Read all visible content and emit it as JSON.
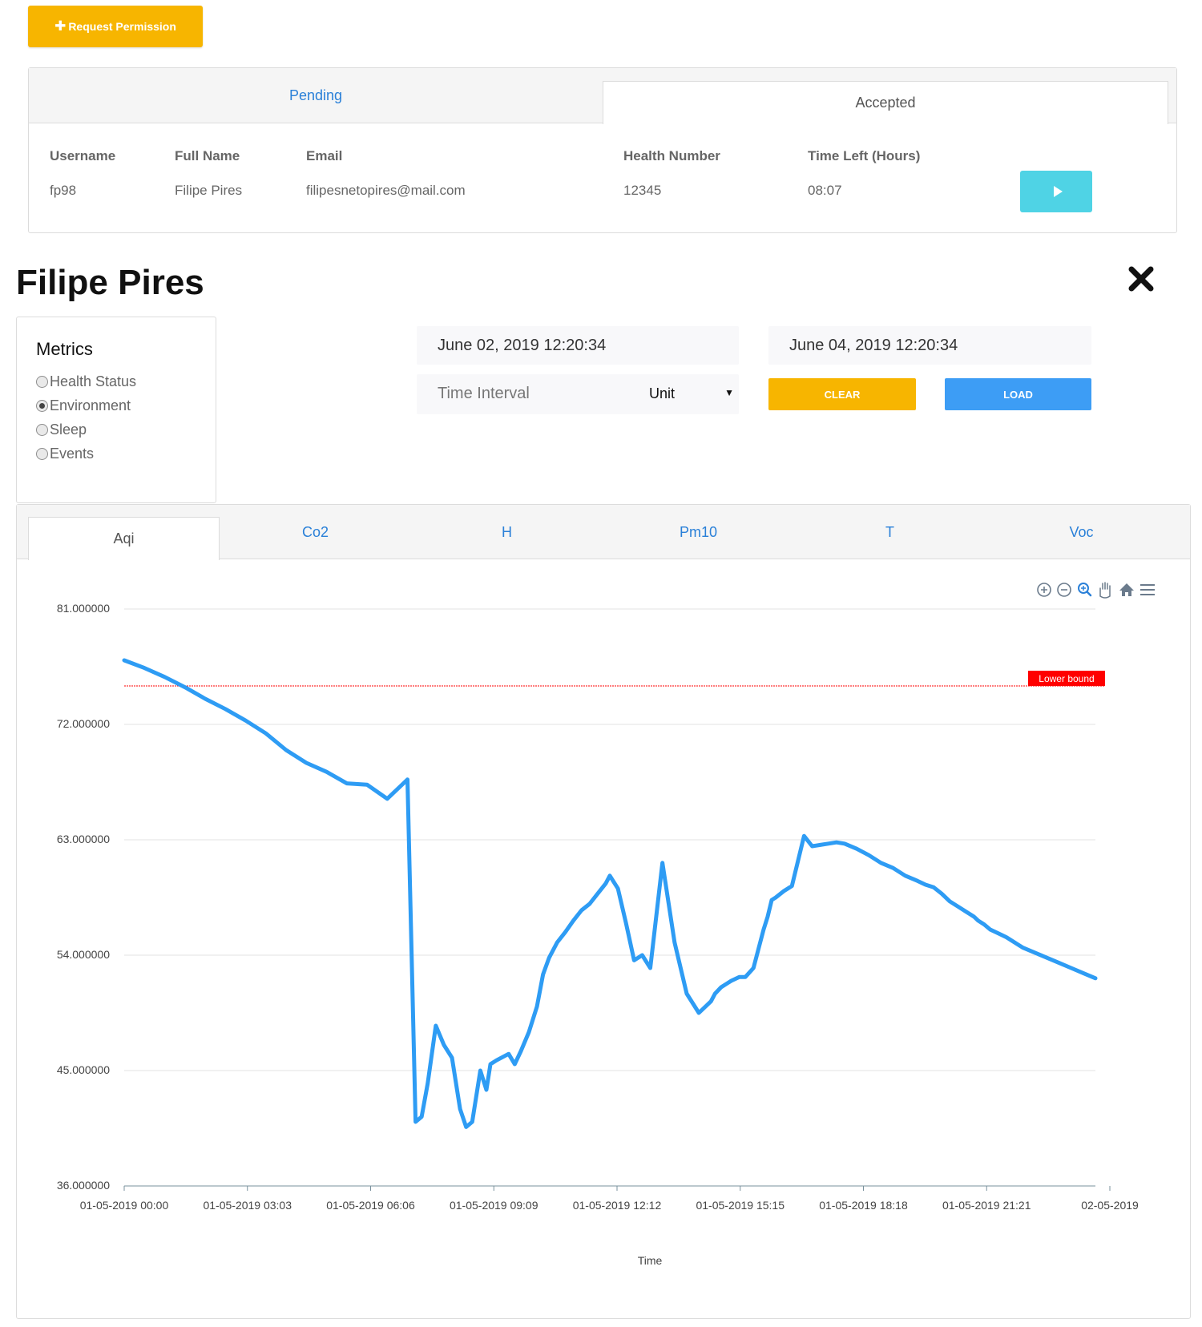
{
  "request_button": {
    "label": "Request Permission"
  },
  "permissions": {
    "tabs": [
      {
        "label": "Pending"
      },
      {
        "label": "Accepted"
      }
    ],
    "columns": [
      "Username",
      "Full Name",
      "Email",
      "Health Number",
      "Time Left (Hours)"
    ],
    "rows": [
      {
        "username": "fp98",
        "full_name": "Filipe Pires",
        "email": "filipesnetopires@mail.com",
        "health_number": "12345",
        "time_left": "08:07"
      }
    ]
  },
  "patient": {
    "name": "Filipe Pires"
  },
  "metrics": {
    "title": "Metrics",
    "options": [
      {
        "label": "Health Status",
        "selected": false
      },
      {
        "label": "Environment",
        "selected": true
      },
      {
        "label": "Sleep",
        "selected": false
      },
      {
        "label": "Events",
        "selected": false
      }
    ]
  },
  "filters": {
    "start_date": "June 02, 2019 12:20:34",
    "end_date": "June 04, 2019 12:20:34",
    "interval_placeholder": "Time Interval",
    "unit_selected": "Unit",
    "clear_label": "CLEAR",
    "load_label": "LOAD"
  },
  "chart_tabs": [
    {
      "label": "Aqi",
      "active": true
    },
    {
      "label": "Co2",
      "active": false
    },
    {
      "label": "H",
      "active": false
    },
    {
      "label": "Pm10",
      "active": false
    },
    {
      "label": "T",
      "active": false
    },
    {
      "label": "Voc",
      "active": false
    }
  ],
  "colors": {
    "accent_yellow": "#f7b500",
    "accent_blue": "#3d9df5",
    "play_cyan": "#4fd3e5",
    "series_line": "#2e9cf4",
    "annotation_red": "#ff0000"
  },
  "chart_toolbar_icons": [
    "zoom-in-icon",
    "zoom-out-icon",
    "selection-zoom-icon",
    "pan-icon",
    "reset-home-icon",
    "menu-icon"
  ],
  "chart_data": {
    "type": "line",
    "xlabel": "Time",
    "ylabel": "",
    "ylim": [
      36,
      81
    ],
    "yticks": [
      "36.000000",
      "45.000000",
      "54.000000",
      "63.000000",
      "72.000000",
      "81.000000"
    ],
    "xticks": [
      "01-05-2019 00:00",
      "01-05-2019 03:03",
      "01-05-2019 06:06",
      "01-05-2019 09:09",
      "01-05-2019 12:12",
      "01-05-2019 15:15",
      "01-05-2019 18:18",
      "01-05-2019 21:21",
      "02-05-2019"
    ],
    "x_hours": [
      0,
      0.5,
      1,
      1.5,
      2,
      2.5,
      3,
      3.5,
      4,
      4.5,
      5,
      5.5,
      6,
      6.5,
      7,
      7.2,
      7.35,
      7.5,
      7.7,
      7.9,
      8.1,
      8.3,
      8.45,
      8.6,
      8.8,
      8.95,
      9.05,
      9.2,
      9.5,
      9.65,
      9.8,
      10.0,
      10.2,
      10.35,
      10.5,
      10.7,
      10.9,
      11.1,
      11.3,
      11.5,
      11.7,
      11.9,
      12.0,
      12.2,
      12.4,
      12.6,
      12.8,
      13.0,
      13.3,
      13.6,
      13.9,
      14.2,
      14.5,
      14.6,
      14.75,
      14.9,
      15.0,
      15.2,
      15.35,
      15.55,
      15.65,
      15.8,
      15.9,
      16.0,
      16.1,
      16.3,
      16.5,
      16.8,
      17.0,
      17.2,
      17.4,
      17.6,
      17.8,
      18.1,
      18.4,
      18.7,
      19.0,
      19.3,
      19.6,
      19.8,
      20.0,
      20.2,
      20.4,
      20.6,
      20.8,
      21.0,
      21.1,
      21.25,
      21.4,
      21.6,
      21.8,
      22.0,
      22.2,
      22.5,
      22.8,
      23.1,
      23.4,
      23.7,
      24.0
    ],
    "series": [
      {
        "values": [
          77.0,
          76.4,
          75.7,
          74.9,
          74.0,
          73.2,
          72.3,
          71.3,
          70.0,
          69.0,
          68.3,
          67.4,
          67.3,
          66.2,
          67.7,
          41.0,
          41.4,
          44.0,
          48.5,
          47.0,
          46.0,
          42.0,
          40.6,
          41.0,
          45.0,
          43.5,
          45.5,
          45.8,
          46.3,
          45.5,
          46.5,
          48.0,
          50.0,
          52.5,
          53.8,
          55.0,
          55.8,
          56.7,
          57.5,
          58.0,
          58.8,
          59.6,
          60.2,
          59.2,
          56.5,
          53.6,
          54.0,
          53.0,
          61.2,
          55.0,
          51.0,
          49.5,
          50.4,
          51.0,
          51.5,
          51.8,
          52.0,
          52.3,
          52.3,
          53.0,
          54.2,
          56.0,
          57.0,
          58.3,
          58.5,
          59.0,
          59.4,
          63.3,
          62.5,
          62.6,
          62.7,
          62.8,
          62.7,
          62.3,
          61.8,
          61.2,
          60.8,
          60.2,
          59.8,
          59.5,
          59.3,
          58.8,
          58.2,
          57.8,
          57.4,
          57.0,
          56.7,
          56.4,
          56.0,
          55.7,
          55.4,
          55.0,
          54.6,
          54.2,
          53.8,
          53.4,
          53.0,
          52.6,
          52.2
        ]
      }
    ],
    "annotations": [
      {
        "type": "hline",
        "y": 75.0,
        "label": "Lower bound",
        "color": "#ff0000"
      }
    ],
    "grid": true,
    "legend": "none"
  }
}
